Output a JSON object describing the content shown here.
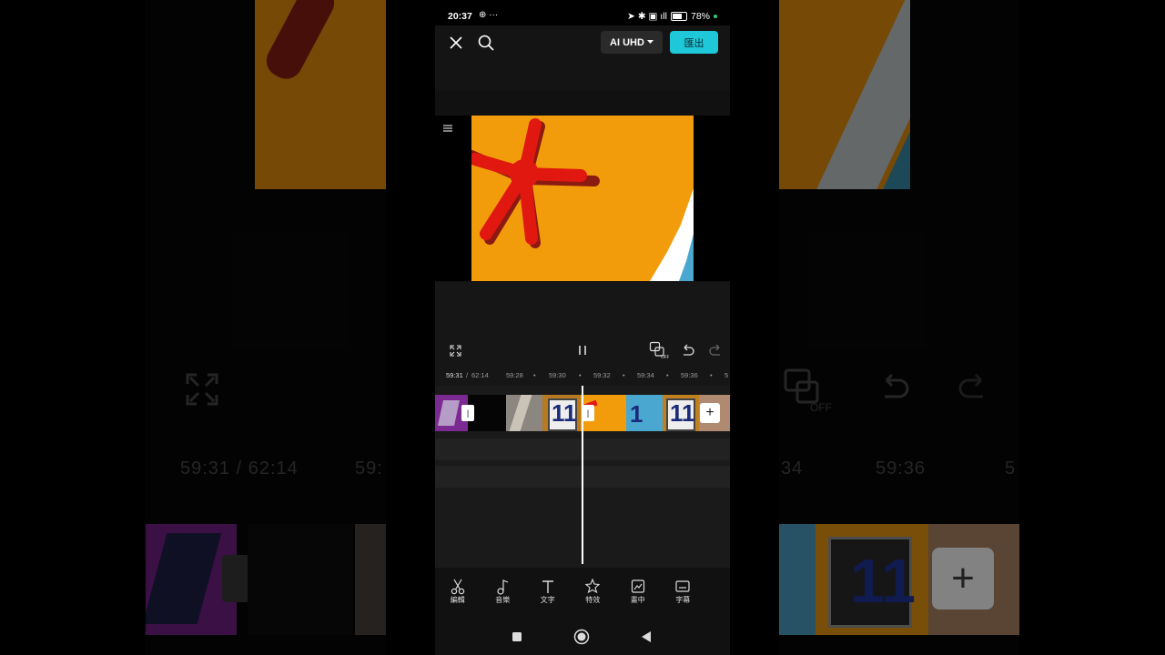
{
  "status_bar": {
    "time": "20:37",
    "left_icons": "⊕ ···",
    "right_icons": "➤ ✱ ▣ ıll",
    "battery": "78%"
  },
  "top_bar": {
    "resolution_label": "AI UHD",
    "export_label": "匯出"
  },
  "timeline": {
    "current_time": "59:31",
    "total_time": "62:14",
    "ticks": [
      "59:28",
      "59:30",
      "59:32",
      "59:34",
      "59:36",
      "5"
    ]
  },
  "toolbar": {
    "items": [
      {
        "label": "編輯",
        "icon": "scissors-icon"
      },
      {
        "label": "音樂",
        "icon": "music-note-icon"
      },
      {
        "label": "文字",
        "icon": "text-icon"
      },
      {
        "label": "特效",
        "icon": "effects-icon"
      },
      {
        "label": "畫中",
        "icon": "overlay-icon"
      },
      {
        "label": "字幕",
        "icon": "captions-icon"
      }
    ]
  },
  "background": {
    "left_time_text": "59:31 / 62:14",
    "left_tick": "59:",
    "right_text_a": "34",
    "right_text_b": "59:36",
    "right_text_c": "5"
  },
  "colors": {
    "accent": "#1ec8d8",
    "canvas_orange": "#f29c0c",
    "star_red": "#e1180f"
  }
}
